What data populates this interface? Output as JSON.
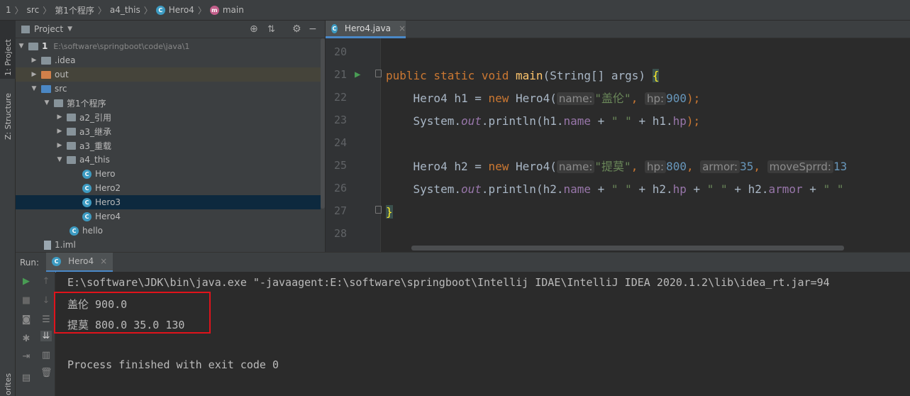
{
  "breadcrumb": {
    "items": [
      "1",
      "src",
      "第1个程序",
      "a4_this",
      "Hero4",
      "main"
    ]
  },
  "sidebar": {
    "project_tab": "1: Project",
    "structure_tab": "Z: Structure",
    "favorites_tab": "orites"
  },
  "project_panel": {
    "title": "Project",
    "root_name": "1",
    "root_path": "E:\\software\\springboot\\code\\java\\1",
    "items": [
      {
        "label": ".idea",
        "icon": "folder-icon"
      },
      {
        "label": "out",
        "icon": "folder-icon"
      },
      {
        "label": "src",
        "icon": "folder-icon"
      },
      {
        "label": "第1个程序",
        "icon": "package-icon"
      },
      {
        "label": "a2_引用",
        "icon": "package-icon"
      },
      {
        "label": "a3_继承",
        "icon": "package-icon"
      },
      {
        "label": "a3_重载",
        "icon": "package-icon"
      },
      {
        "label": "a4_this",
        "icon": "package-icon"
      },
      {
        "label": "Hero",
        "icon": "class-icon"
      },
      {
        "label": "Hero2",
        "icon": "class-icon"
      },
      {
        "label": "Hero3",
        "icon": "class-icon"
      },
      {
        "label": "Hero4",
        "icon": "class-icon"
      },
      {
        "label": "hello",
        "icon": "class-icon"
      },
      {
        "label": "1.iml",
        "icon": "file-icon"
      }
    ]
  },
  "editor": {
    "tab_label": "Hero4.java",
    "line_numbers": [
      "20",
      "21",
      "22",
      "23",
      "24",
      "25",
      "26",
      "27",
      "28"
    ],
    "lines": {
      "l21": {
        "a": "public static void ",
        "b": "main",
        "c": "(String[] args) ",
        "d": "{"
      },
      "l22": {
        "a": "    Hero4 h1 = ",
        "b": "new ",
        "c": "Hero4(",
        "h1": "name:",
        "s1": "\"盖伦\"",
        "c2": ", ",
        "h2": "hp:",
        "n1": "900",
        "c3": ");"
      },
      "l23": {
        "a": "    System.",
        "b": "out",
        "c": ".println(h1.",
        "d": "name",
        "e": " + ",
        "f": "\" \"",
        "g": " + h1.",
        "h": "hp",
        "i": ");"
      },
      "l25": {
        "a": "    Hero4 h2 = ",
        "b": "new ",
        "c": "Hero4(",
        "h1": "name:",
        "s1": "\"提莫\"",
        "c2": ", ",
        "h2": "hp:",
        "n1": "800",
        "c3": ", ",
        "h3": "armor:",
        "n2": "35",
        "c4": ", ",
        "h4": "moveSprrd:",
        "n3": "13"
      },
      "l26": {
        "a": "    System.",
        "b": "out",
        "c": ".println(h2.",
        "d": "name",
        "e": " + ",
        "f": "\" \"",
        "g": " + h2.",
        "h": "hp",
        "i": " + ",
        "j": "\" \"",
        "k": " + h2.",
        "l": "armor",
        "m": " + ",
        "n": "\" \""
      },
      "l27": {
        "a": "}"
      }
    }
  },
  "run": {
    "label": "Run:",
    "tab_label": "Hero4",
    "console": {
      "cmd": "E:\\software\\JDK\\bin\\java.exe \"-javaagent:E:\\software\\springboot\\Intellij IDAE\\IntelliJ IDEA 2020.1.2\\lib\\idea_rt.jar=94",
      "out1": "盖伦 900.0",
      "out2": "提莫 800.0 35.0 130",
      "finish": "Process finished with exit code 0"
    }
  }
}
